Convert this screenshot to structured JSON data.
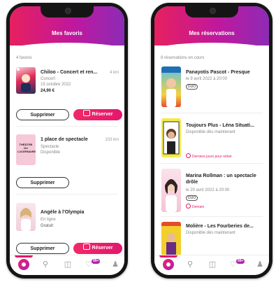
{
  "favorites": {
    "header_title": "Mes favoris",
    "count_label": "4 favoris",
    "items": [
      {
        "title": "Chiloo - Concert et ren...",
        "distance": "4 km",
        "category": "Concert",
        "date": "15 octobre 2022",
        "price": "24,90 €"
      },
      {
        "title": "1 place de spectacle",
        "distance": "103 km",
        "category": "Spectacle",
        "availability": "Disponible",
        "poster_text": "THÉÂTRE DU LUCERNAIRE"
      },
      {
        "title": "Angèle à l'Olympia",
        "category": "En ligne",
        "price": "Gratuit"
      }
    ],
    "delete_label": "Supprimer",
    "reserve_label": "Réserver"
  },
  "reservations": {
    "header_title": "Mes réservations",
    "count_label": "8 réservations en cours",
    "items": [
      {
        "title": "Panayotis Pascot - Presque",
        "date": "le 9 avril 2022 à 20:00",
        "badge": "DUO"
      },
      {
        "title": "Toujours Plus - Léna Situati...",
        "availability": "Disponible dès maintenant",
        "warning": "Derniers jours pour retirer"
      },
      {
        "title_line1": "Marina Rollman : un spectacle",
        "title_line2": "drôle",
        "date": "le 20 avril 2022 à 20:00",
        "badge": "DUO",
        "warning": "Demain"
      },
      {
        "title": "Molière - Les Fourberies de...",
        "availability": "Disponible dès maintenant"
      }
    ]
  },
  "tabbar": {
    "badge": "99+"
  },
  "colors": {
    "accent": "#e3186a",
    "gradient_start": "#e7205e",
    "gradient_end": "#8d2bb6"
  }
}
